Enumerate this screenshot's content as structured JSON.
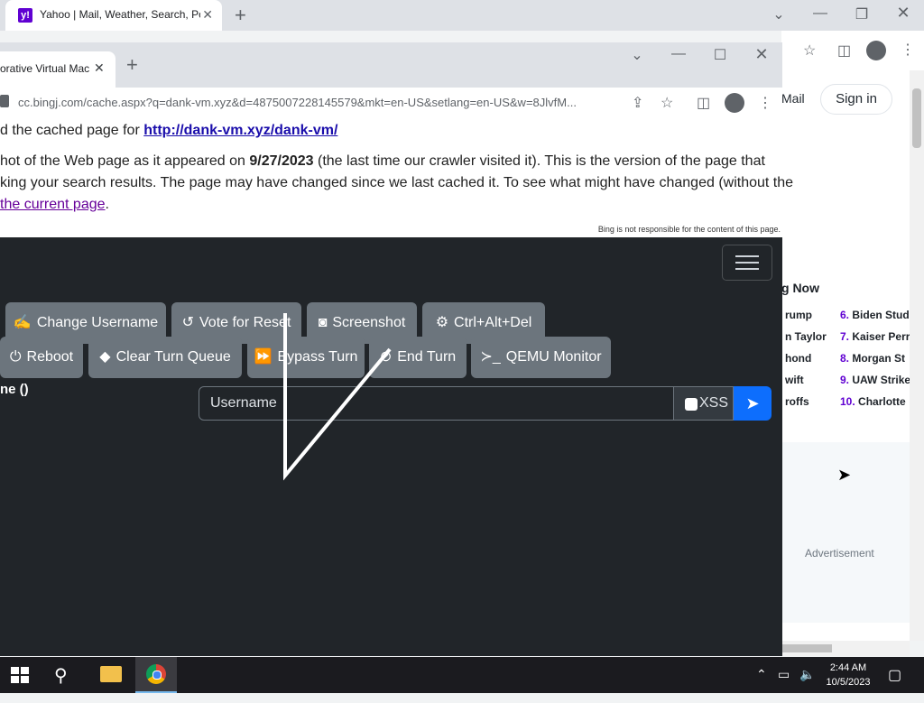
{
  "back_browser": {
    "tab_title": "Yahoo | Mail, Weather, Search, Po",
    "favicon_letter": "y!",
    "mail_label": "Mail",
    "signin_label": "Sign in",
    "trending_heading": "g Now",
    "trending_left": [
      "rump",
      "n Taylor",
      "hond",
      "wift",
      "roffs"
    ],
    "trending_right": [
      {
        "num": "6.",
        "label": "Biden Stud"
      },
      {
        "num": "7.",
        "label": "Kaiser Perr"
      },
      {
        "num": "8.",
        "label": "Morgan St"
      },
      {
        "num": "9.",
        "label": "UAW Strike"
      },
      {
        "num": "10.",
        "label": "Charlotte"
      }
    ],
    "advertisement": "Advertisement"
  },
  "front_browser": {
    "tab_title": "orative Virtual Mac",
    "address": "cc.bingj.com/cache.aspx?q=dank-vm.xyz&d=4875007228145579&mkt=en-US&setlang=en-US&w=8JlvfM..."
  },
  "cache_banner": {
    "line1_prefix": "d the cached page for ",
    "line1_link": "http://dank-vm.xyz/dank-vm/",
    "line2_prefix": "hot of the Web page as it appeared on ",
    "line2_date": "9/27/2023",
    "line2_suffix": " (the last time our crawler visited it). This is the version of the page that",
    "line3": "king your search results. The page may have changed since we last cached it. To see what might have changed (without the",
    "line4_link": " the current page",
    "line4_suffix": ".",
    "note": "Bing is not responsible for the content of this page."
  },
  "vm": {
    "buttons_row1": [
      {
        "icon": "✍",
        "label": "Change Username"
      },
      {
        "icon": "↺",
        "label": "Vote for Reset"
      },
      {
        "icon": "◙",
        "label": "Screenshot"
      },
      {
        "icon": "⚙",
        "label": "Ctrl+Alt+Del"
      }
    ],
    "buttons_row2": [
      {
        "icon": "⏻",
        "label": "Reboot"
      },
      {
        "icon": "◆",
        "label": "Clear Turn Queue"
      },
      {
        "icon": "⏩",
        "label": "Bypass Turn"
      },
      {
        "icon": "⊘",
        "label": "End Turn"
      },
      {
        "icon": "≻_",
        "label": "QEMU Monitor"
      }
    ],
    "username_label": "ne ()",
    "chat_placeholder": "Username",
    "xss_label": "XSS"
  },
  "taskbar": {
    "time": "2:44 AM",
    "date": "10/5/2023"
  }
}
